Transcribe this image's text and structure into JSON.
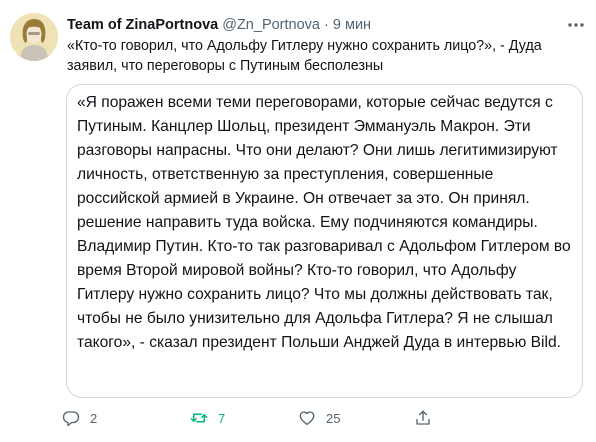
{
  "tweet": {
    "author_name": "Team of ZinaPortnova",
    "author_handle": "@Zn_Portnova",
    "separator": "·",
    "time": "9 мин",
    "text": "«Кто-то говорил, что Адольфу Гитлеру нужно сохранить лицо?», - Дуда заявил, что переговоры с Путиным бесполезны",
    "quote": "«Я поражен всеми теми переговорами, которые сейчас ведутся с Путиным. Канцлер Шольц, президент Эммануэль Макрон. Эти разговоры напрасны. Что они делают? Они лишь легитимизируют личность, ответственную за преступления, совершенные российской армией в Украине. Он отвечает за это. Он принял. решение направить туда войска. Ему подчиняются командиры. Владимир Путин. Кто-то так разговаривал с Адольфом Гитлером во время Второй мировой войны? Кто-то говорил, что Адольфу Гитлеру нужно сохранить лицо? Что мы должны действовать так, чтобы не было унизительно для Адольфа Гитлера? Я не слышал такого», - сказал президент Польши Анджей Дуда в интервью Bild.",
    "actions": {
      "reply": {
        "icon": "reply-icon",
        "count": "2"
      },
      "retweet": {
        "icon": "retweet-icon",
        "count": "7",
        "active": true,
        "color": "#00ba7c"
      },
      "like": {
        "icon": "like-icon",
        "count": "25"
      },
      "share": {
        "icon": "share-icon"
      }
    }
  },
  "colors": {
    "text": "#0f1419",
    "secondary": "#536471",
    "border": "#cfd9de",
    "retweet_active": "#00ba7c"
  }
}
